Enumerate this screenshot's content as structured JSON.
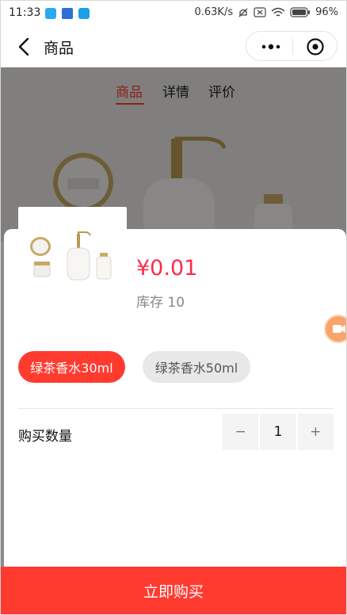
{
  "status_bar": {
    "time": "11:33",
    "network_speed": "0.63K/s",
    "battery": "96%"
  },
  "nav": {
    "title": "商品"
  },
  "tabs": [
    {
      "label": "商品",
      "active": true
    },
    {
      "label": "详情",
      "active": false
    },
    {
      "label": "评价",
      "active": false
    }
  ],
  "sheet": {
    "price": "¥0.01",
    "stock": "库存 10",
    "specs": [
      {
        "label": "绿茶香水30ml",
        "selected": true
      },
      {
        "label": "绿茶香水50ml",
        "selected": false
      }
    ],
    "quantity_label": "购买数量",
    "quantity": "1",
    "minus": "−",
    "plus": "+"
  },
  "buy_button": "立即购买",
  "colors": {
    "accent": "#ff3b30",
    "price": "#ff2a4a"
  }
}
